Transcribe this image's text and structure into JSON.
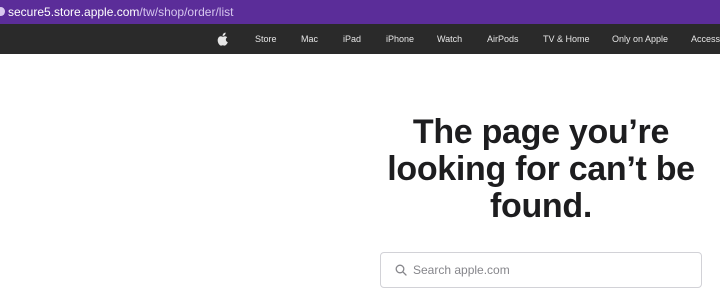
{
  "browser": {
    "url_host": "secure5.store.apple.com",
    "url_path": "/tw/shop/order/list"
  },
  "nav": {
    "logo_icon": "apple-logo-icon",
    "items": [
      "Store",
      "Mac",
      "iPad",
      "iPhone",
      "Watch",
      "AirPods",
      "TV & Home",
      "Only on Apple",
      "Accesso"
    ]
  },
  "main": {
    "headline": "The page you’re looking for can’t be found."
  },
  "search": {
    "icon": "search-icon",
    "placeholder": "Search apple.com",
    "value": ""
  },
  "colors": {
    "url_bar": "#5b2d99",
    "nav_bg": "#2a2a2a",
    "text": "#1d1d1f"
  }
}
